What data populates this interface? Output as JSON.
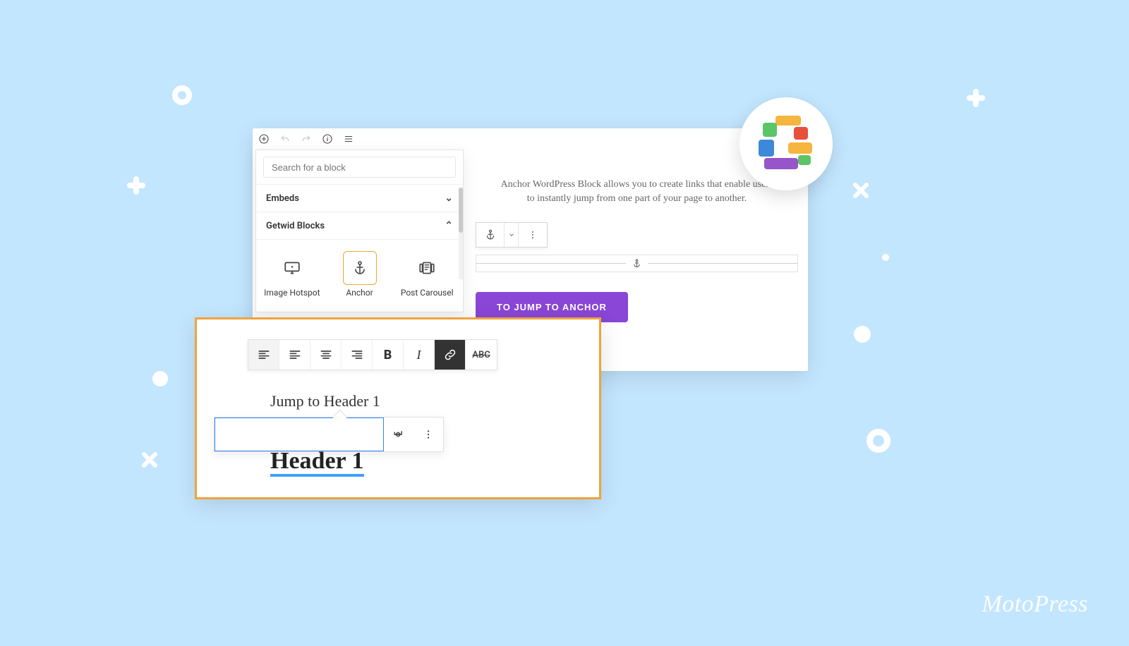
{
  "brand": "MotoPress",
  "editor": {
    "search_placeholder": "Search for a block",
    "sections": {
      "embeds_label": "Embeds",
      "getwid_label": "Getwid Blocks"
    },
    "blocks": {
      "image_hotspot": "Image Hotspot",
      "anchor": "Anchor",
      "post_carousel": "Post Carousel"
    },
    "top_icons": [
      "add",
      "undo",
      "redo",
      "info",
      "menu"
    ]
  },
  "preview": {
    "description": "Anchor WordPress Block allows you to create links that enable users to instantly jump from one part of your page to another.",
    "jump_button": "TO JUMP TO ANCHOR"
  },
  "highlight": {
    "paragraph": "Jump to Header 1",
    "heading": "Header 1",
    "abc_label": "ABC"
  },
  "colors": {
    "accent": "#2b86ff",
    "orange": "#f0a33b",
    "purple": "#8a46d6"
  }
}
